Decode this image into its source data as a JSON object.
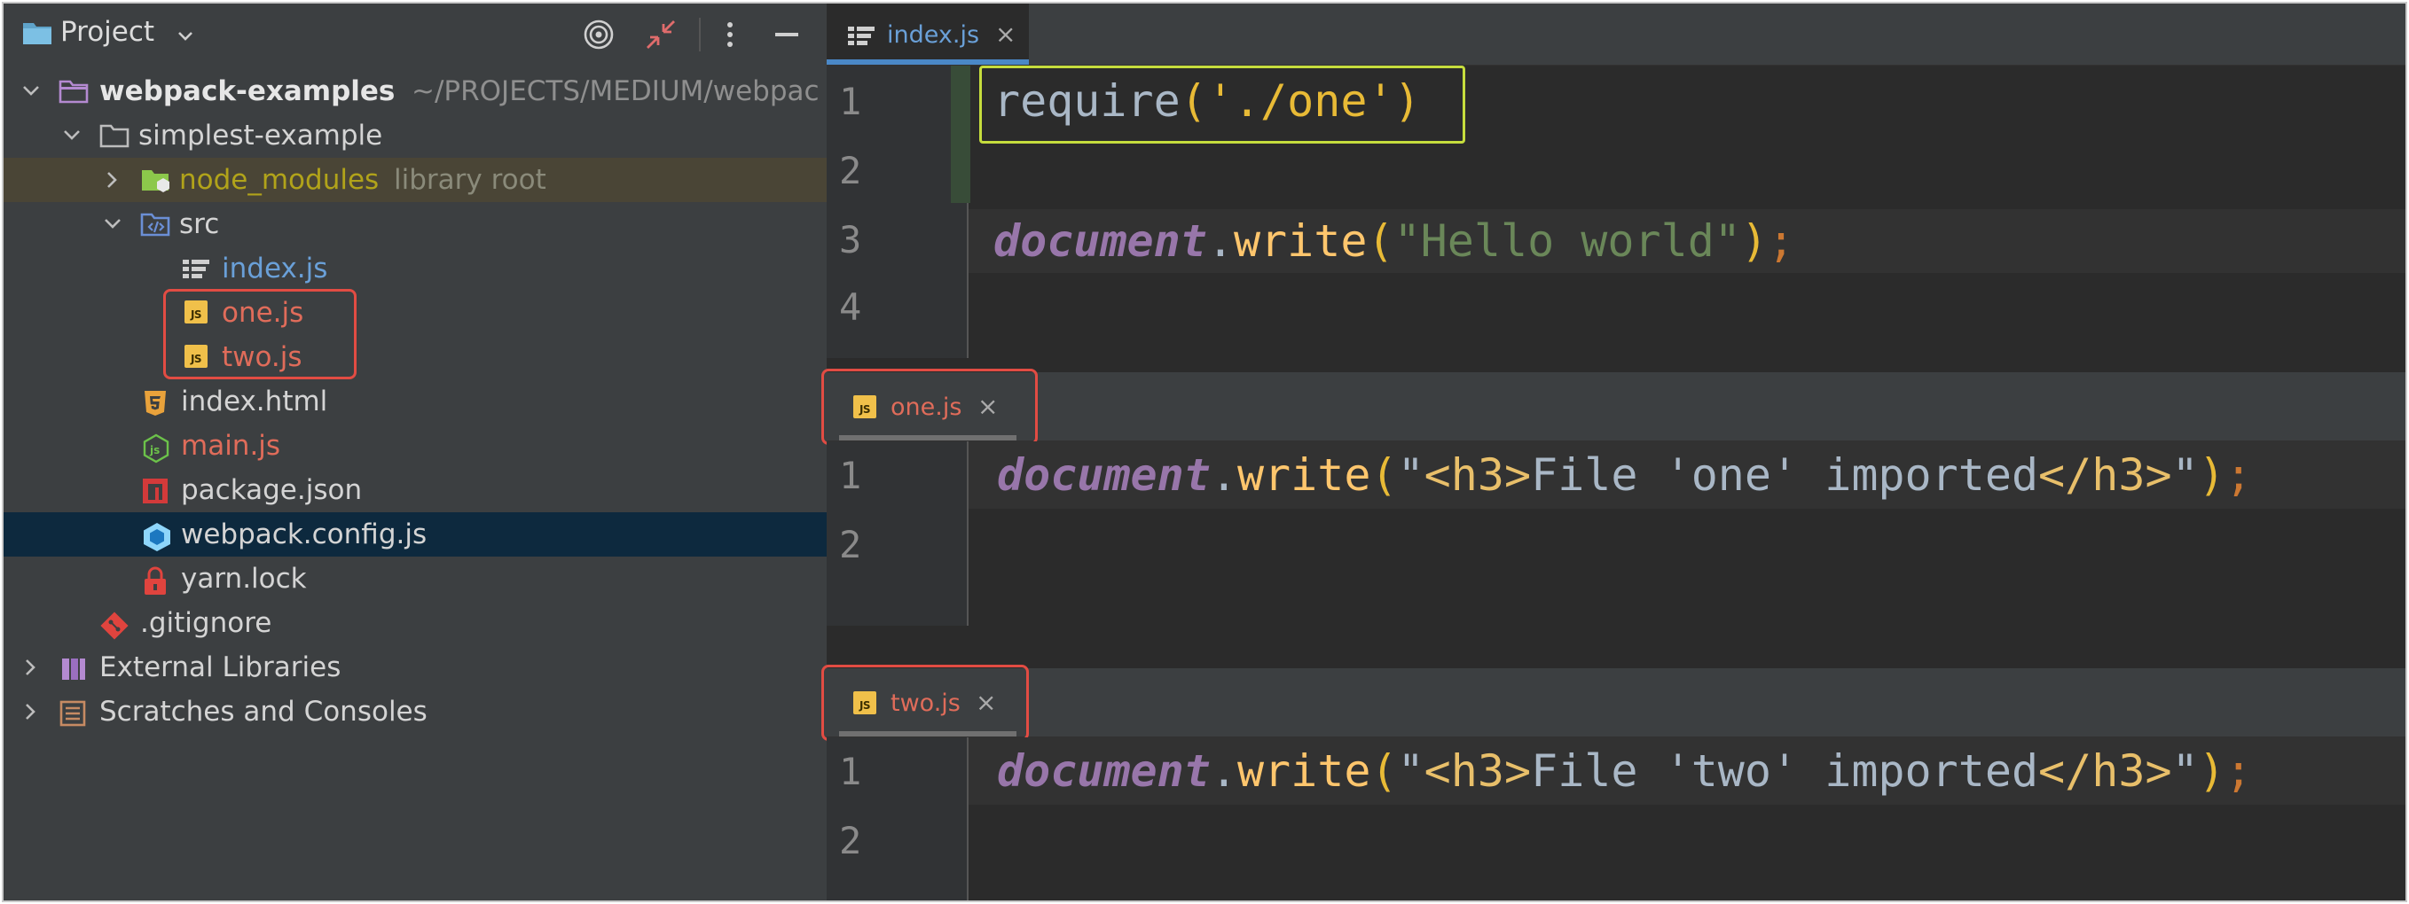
{
  "project_panel": {
    "title": "Project",
    "tree": {
      "root": {
        "name": "webpack-examples",
        "path": "~/PROJECTS/MEDIUM/webpac"
      },
      "simplest_example": "simplest-example",
      "node_modules": {
        "name": "node_modules",
        "suffix": "library root"
      },
      "src": "src",
      "index_js": "index.js",
      "one_js": "one.js",
      "two_js": "two.js",
      "index_html": "index.html",
      "main_js": "main.js",
      "package_json": "package.json",
      "webpack_config": "webpack.config.js",
      "yarn_lock": "yarn.lock",
      "gitignore": ".gitignore",
      "external_libraries": "External Libraries",
      "scratches": "Scratches and Consoles"
    }
  },
  "editors": [
    {
      "tab": "index.js",
      "line_numbers": [
        "1",
        "2",
        "3",
        "4"
      ]
    },
    {
      "tab": "one.js",
      "line_numbers": [
        "1",
        "2"
      ]
    },
    {
      "tab": "two.js",
      "line_numbers": [
        "1",
        "2"
      ]
    }
  ],
  "code": {
    "require_kw": "require",
    "require_arg": "'./one'",
    "document": "document",
    "write": "write",
    "hello": "\"Hello world\"",
    "one_str_a": "\"",
    "h3_open": "<h3>",
    "one_text": "File 'one' imported",
    "h3_close": "</h3>",
    "two_text": "File 'two' imported"
  },
  "icon_badge_text": "JS"
}
